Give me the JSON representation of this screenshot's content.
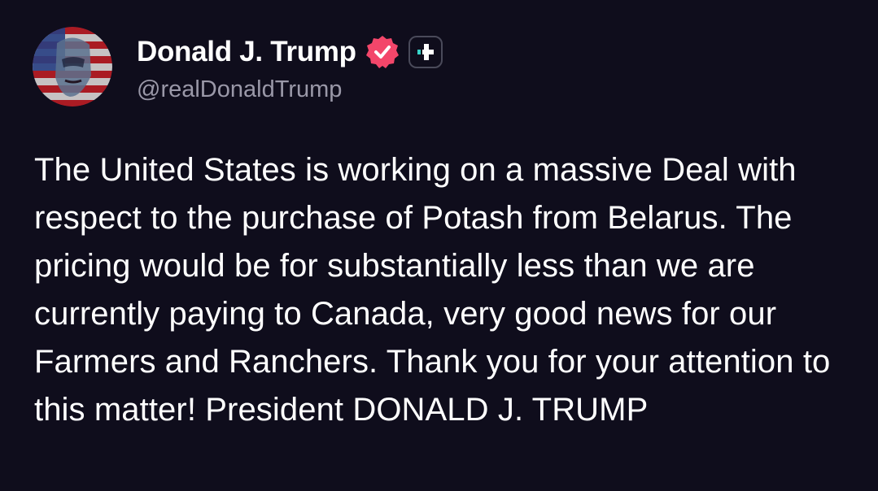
{
  "post": {
    "author": {
      "display_name": "Donald J. Trump",
      "handle": "@realDonaldTrump",
      "avatar_icon": "user-avatar",
      "verified_icon": "verified-badge-icon",
      "plus_icon": "plus-icon"
    },
    "text": "The United States is working on a massive Deal with respect to the purchase of Potash from Belarus. The pricing would be for substantially less than we are currently paying to Canada, very good news for our Farmers and Ranchers. Thank you for your attention to this matter! President DONALD J. TRUMP"
  },
  "colors": {
    "background": "#0f0d1c",
    "text": "#ffffff",
    "handle": "#9a98a8",
    "verified_badge": "#f3466a",
    "plus_accent": "#37d3c8"
  }
}
